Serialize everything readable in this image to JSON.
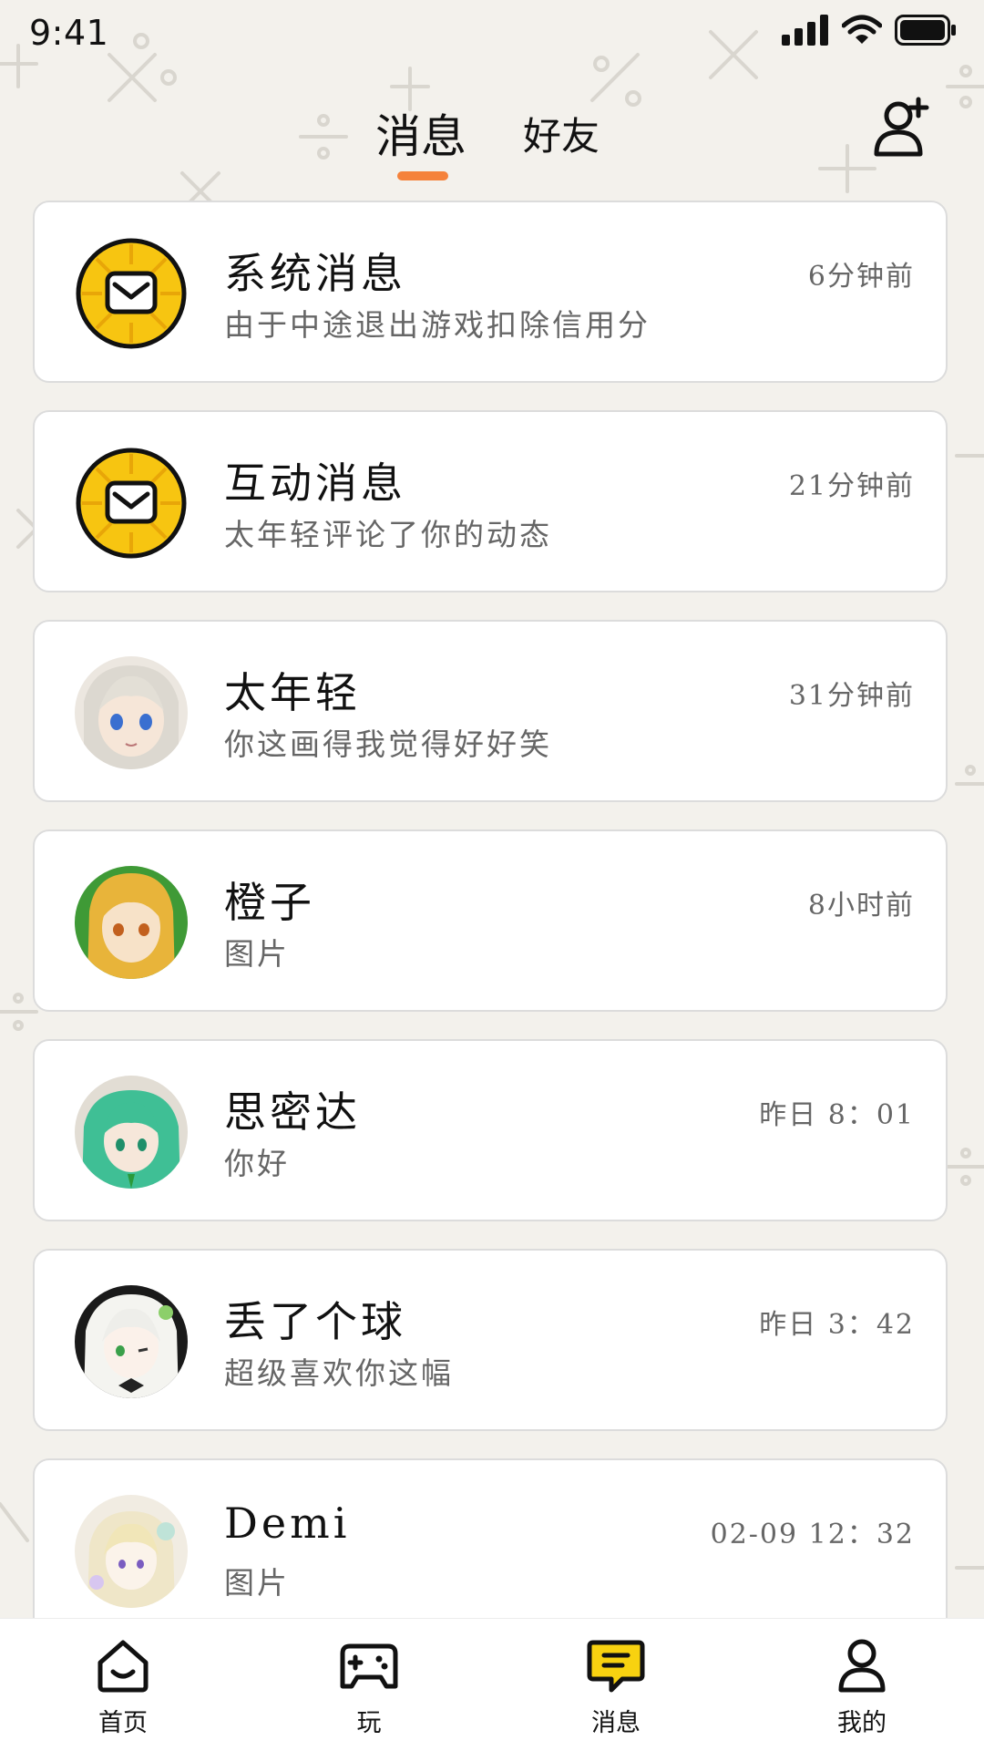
{
  "status_bar": {
    "time": "9:41"
  },
  "header": {
    "tabs": [
      {
        "label": "消息",
        "active": true
      },
      {
        "label": "好友",
        "active": false
      }
    ],
    "add_friend_icon": "add-friend-icon",
    "accent_color": "#f5823b"
  },
  "conversations": [
    {
      "name": "系统消息",
      "preview": "由于中途退出游戏扣除信用分",
      "time": "6分钟前",
      "avatar": "mail-badge-icon"
    },
    {
      "name": "互动消息",
      "preview": "太年轻评论了你的动态",
      "time": "21分钟前",
      "avatar": "mail-badge-icon"
    },
    {
      "name": "太年轻",
      "preview": "你这画得我觉得好好笑",
      "time": "31分钟前",
      "avatar": "user-avatar"
    },
    {
      "name": "橙子",
      "preview": "图片",
      "time": "8小时前",
      "avatar": "user-avatar"
    },
    {
      "name": "思密达",
      "preview": "你好",
      "time": "昨日 8：01",
      "avatar": "user-avatar"
    },
    {
      "name": "丢了个球",
      "preview": "超级喜欢你这幅",
      "time": "昨日 3：42",
      "avatar": "user-avatar"
    },
    {
      "name": "Demi",
      "preview": "图片",
      "time": "02-09 12：32",
      "avatar": "user-avatar"
    }
  ],
  "bottom_nav": [
    {
      "label": "首页",
      "icon": "home-icon"
    },
    {
      "label": "玩",
      "icon": "gamepad-icon"
    },
    {
      "label": "消息",
      "icon": "message-icon",
      "active": true
    },
    {
      "label": "我的",
      "icon": "profile-icon"
    }
  ],
  "colors": {
    "badge_yellow": "#f7c511",
    "message_icon_yellow": "#f8d210",
    "background": "#f3f1ec"
  }
}
